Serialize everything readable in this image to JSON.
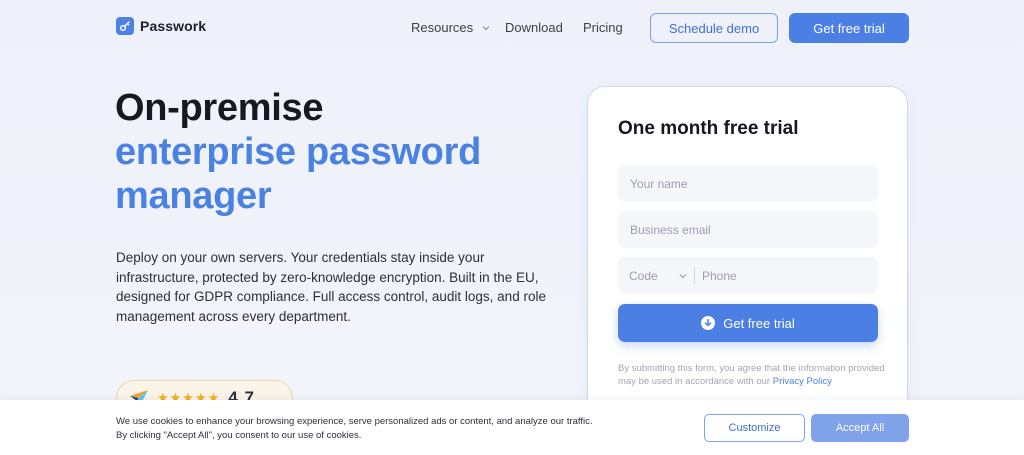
{
  "header": {
    "logo_text": "Passwork",
    "nav": {
      "resources": "Resources",
      "download": "Download",
      "pricing": "Pricing"
    },
    "schedule_demo": "Schedule demo",
    "get_free_trial": "Get free trial"
  },
  "hero": {
    "title_line1": "On-premise",
    "title_line2": "enterprise password",
    "title_line3": "manager",
    "description": "Deploy on your own servers. Your credentials stay inside your infrastructure, protected by zero-knowledge encryption. Built in the EU, designed for GDPR compliance. Full access control, audit logs, and role management across every department.",
    "rating_stars": "★★★★★",
    "rating_value": "4.7"
  },
  "form": {
    "title": "One month free trial",
    "name_placeholder": "Your name",
    "email_placeholder": "Business email",
    "code_label": "Code",
    "phone_placeholder": "Phone",
    "submit_label": "Get free trial",
    "consent_text": "By submitting this form, you agree that the information provided may be used in accordance with our ",
    "privacy_link": "Privacy Policy"
  },
  "cookie": {
    "line1": "We use cookies to enhance your browsing experience, serve personalized ads or content, and analyze our traffic.",
    "line2": "By clicking \"Accept All\", you consent to our use of cookies.",
    "customize": "Customize",
    "accept_all": "Accept All"
  },
  "colors": {
    "accent": "#4b7fe3",
    "accent_light": "#7fa2e8",
    "heading_blue": "#4b82e2",
    "star": "#f2b01e"
  }
}
